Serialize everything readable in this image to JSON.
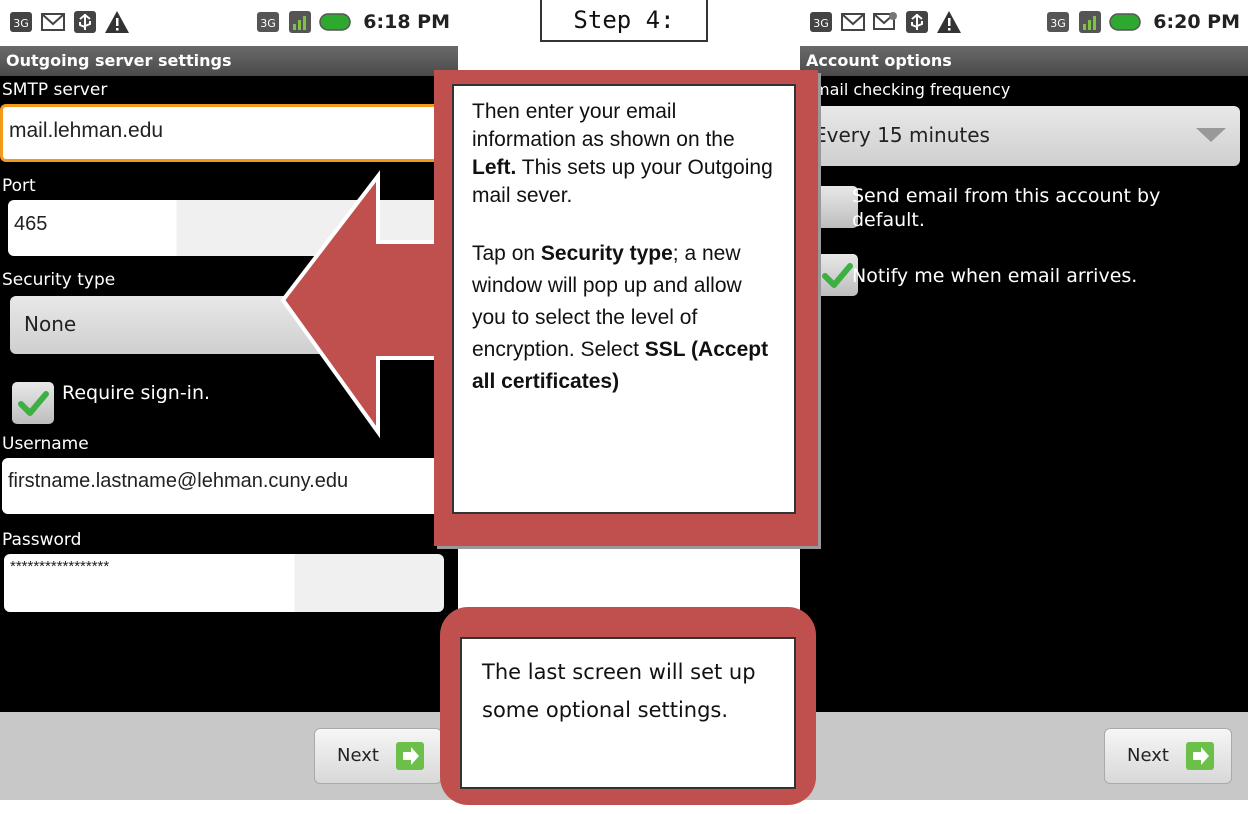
{
  "step": {
    "label": "Step 4:"
  },
  "left_screen": {
    "status_time": "6:18 PM",
    "title": "Outgoing server settings",
    "smtp_label": "SMTP server",
    "smtp_value": "mail.lehman.edu",
    "port_label": "Port",
    "port_value": "465",
    "security_label": "Security type",
    "security_value": "None",
    "require_signin_label": "Require sign-in.",
    "require_signin_checked": true,
    "username_label": "Username",
    "username_value": "firstname.lastname@lehman.cuny.edu",
    "password_label": "Password",
    "password_value": "*****************",
    "next_label": "Next",
    "icons": [
      "network-3g-icon",
      "email-icon",
      "usb-icon",
      "warning-icon",
      "3g-icon",
      "signal-icon",
      "battery-icon"
    ]
  },
  "right_screen": {
    "status_time": "6:20 PM",
    "title": "Account options",
    "frequency_label": "mail checking frequency",
    "frequency_value": "Every 15 minutes",
    "default_label_line1": "Send email from this account by",
    "default_label_line2": "default.",
    "default_checked": false,
    "notify_label": "Notify me when email arrives.",
    "notify_checked": true,
    "next_label": "Next"
  },
  "callout": {
    "p1_part1": "Then enter your email information as shown on the ",
    "p1_bold": "Left.",
    "p1_part2": " This sets up your Outgoing mail sever.",
    "p2_part1": "Tap on ",
    "p2_bold1": "Security type",
    "p2_part2": "; a new window will pop up and allow you to select the level of encryption. Select ",
    "p2_bold2": "SSL (Accept all certificates)"
  },
  "note": {
    "text": "The last screen will set up some optional settings."
  },
  "colors": {
    "callout_red": "#c0504d",
    "focus_orange": "#f39a1a",
    "check_green": "#3cb043"
  }
}
